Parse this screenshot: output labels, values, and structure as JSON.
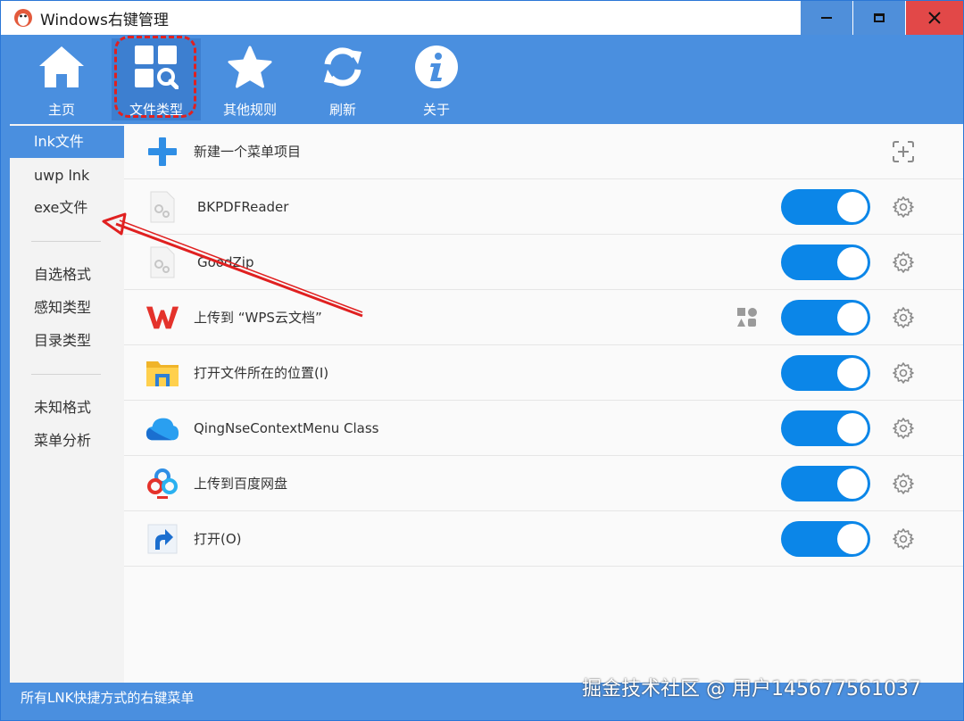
{
  "window": {
    "title": "Windows右键管理",
    "colors": {
      "accent": "#4a8fdf",
      "toggle_on": "#0b86e8",
      "close": "#e24848",
      "annotation": "#e02020"
    }
  },
  "toolbar": {
    "items": [
      {
        "label": "主页",
        "icon": "home-icon"
      },
      {
        "label": "文件类型",
        "icon": "file-type-icon",
        "active": true
      },
      {
        "label": "其他规则",
        "icon": "star-icon"
      },
      {
        "label": "刷新",
        "icon": "refresh-icon"
      },
      {
        "label": "关于",
        "icon": "info-icon"
      }
    ]
  },
  "sidebar": {
    "groups": [
      [
        "lnk文件",
        "uwp lnk",
        "exe文件"
      ],
      [
        "自选格式",
        "感知类型",
        "目录类型"
      ],
      [
        "未知格式",
        "菜单分析"
      ]
    ],
    "active": "lnk文件"
  },
  "list": {
    "new_item_label": "新建一个菜单项目",
    "items": [
      {
        "label": "BKPDFReader",
        "icon": "blank-file-gear-icon",
        "enabled": true
      },
      {
        "label": "GoodZip",
        "icon": "blank-file-gear-icon",
        "enabled": true
      },
      {
        "label": "上传到 “WPS云文档”",
        "icon": "wps-icon",
        "enabled": true,
        "extra_icon": "shapes-icon"
      },
      {
        "label": "打开文件所在的位置(I)",
        "icon": "folder-icon",
        "enabled": true
      },
      {
        "label": "QingNseContextMenu Class",
        "icon": "cloud-icon",
        "enabled": true
      },
      {
        "label": "上传到百度网盘",
        "icon": "baidu-netdisk-icon",
        "enabled": true
      },
      {
        "label": "打开(O)",
        "icon": "shortcut-arrow-icon",
        "enabled": true
      }
    ]
  },
  "statusbar": {
    "text": "所有LNK快捷方式的右键菜单"
  },
  "watermark": {
    "text": "掘金技术社区 @ 用户145677561037"
  }
}
